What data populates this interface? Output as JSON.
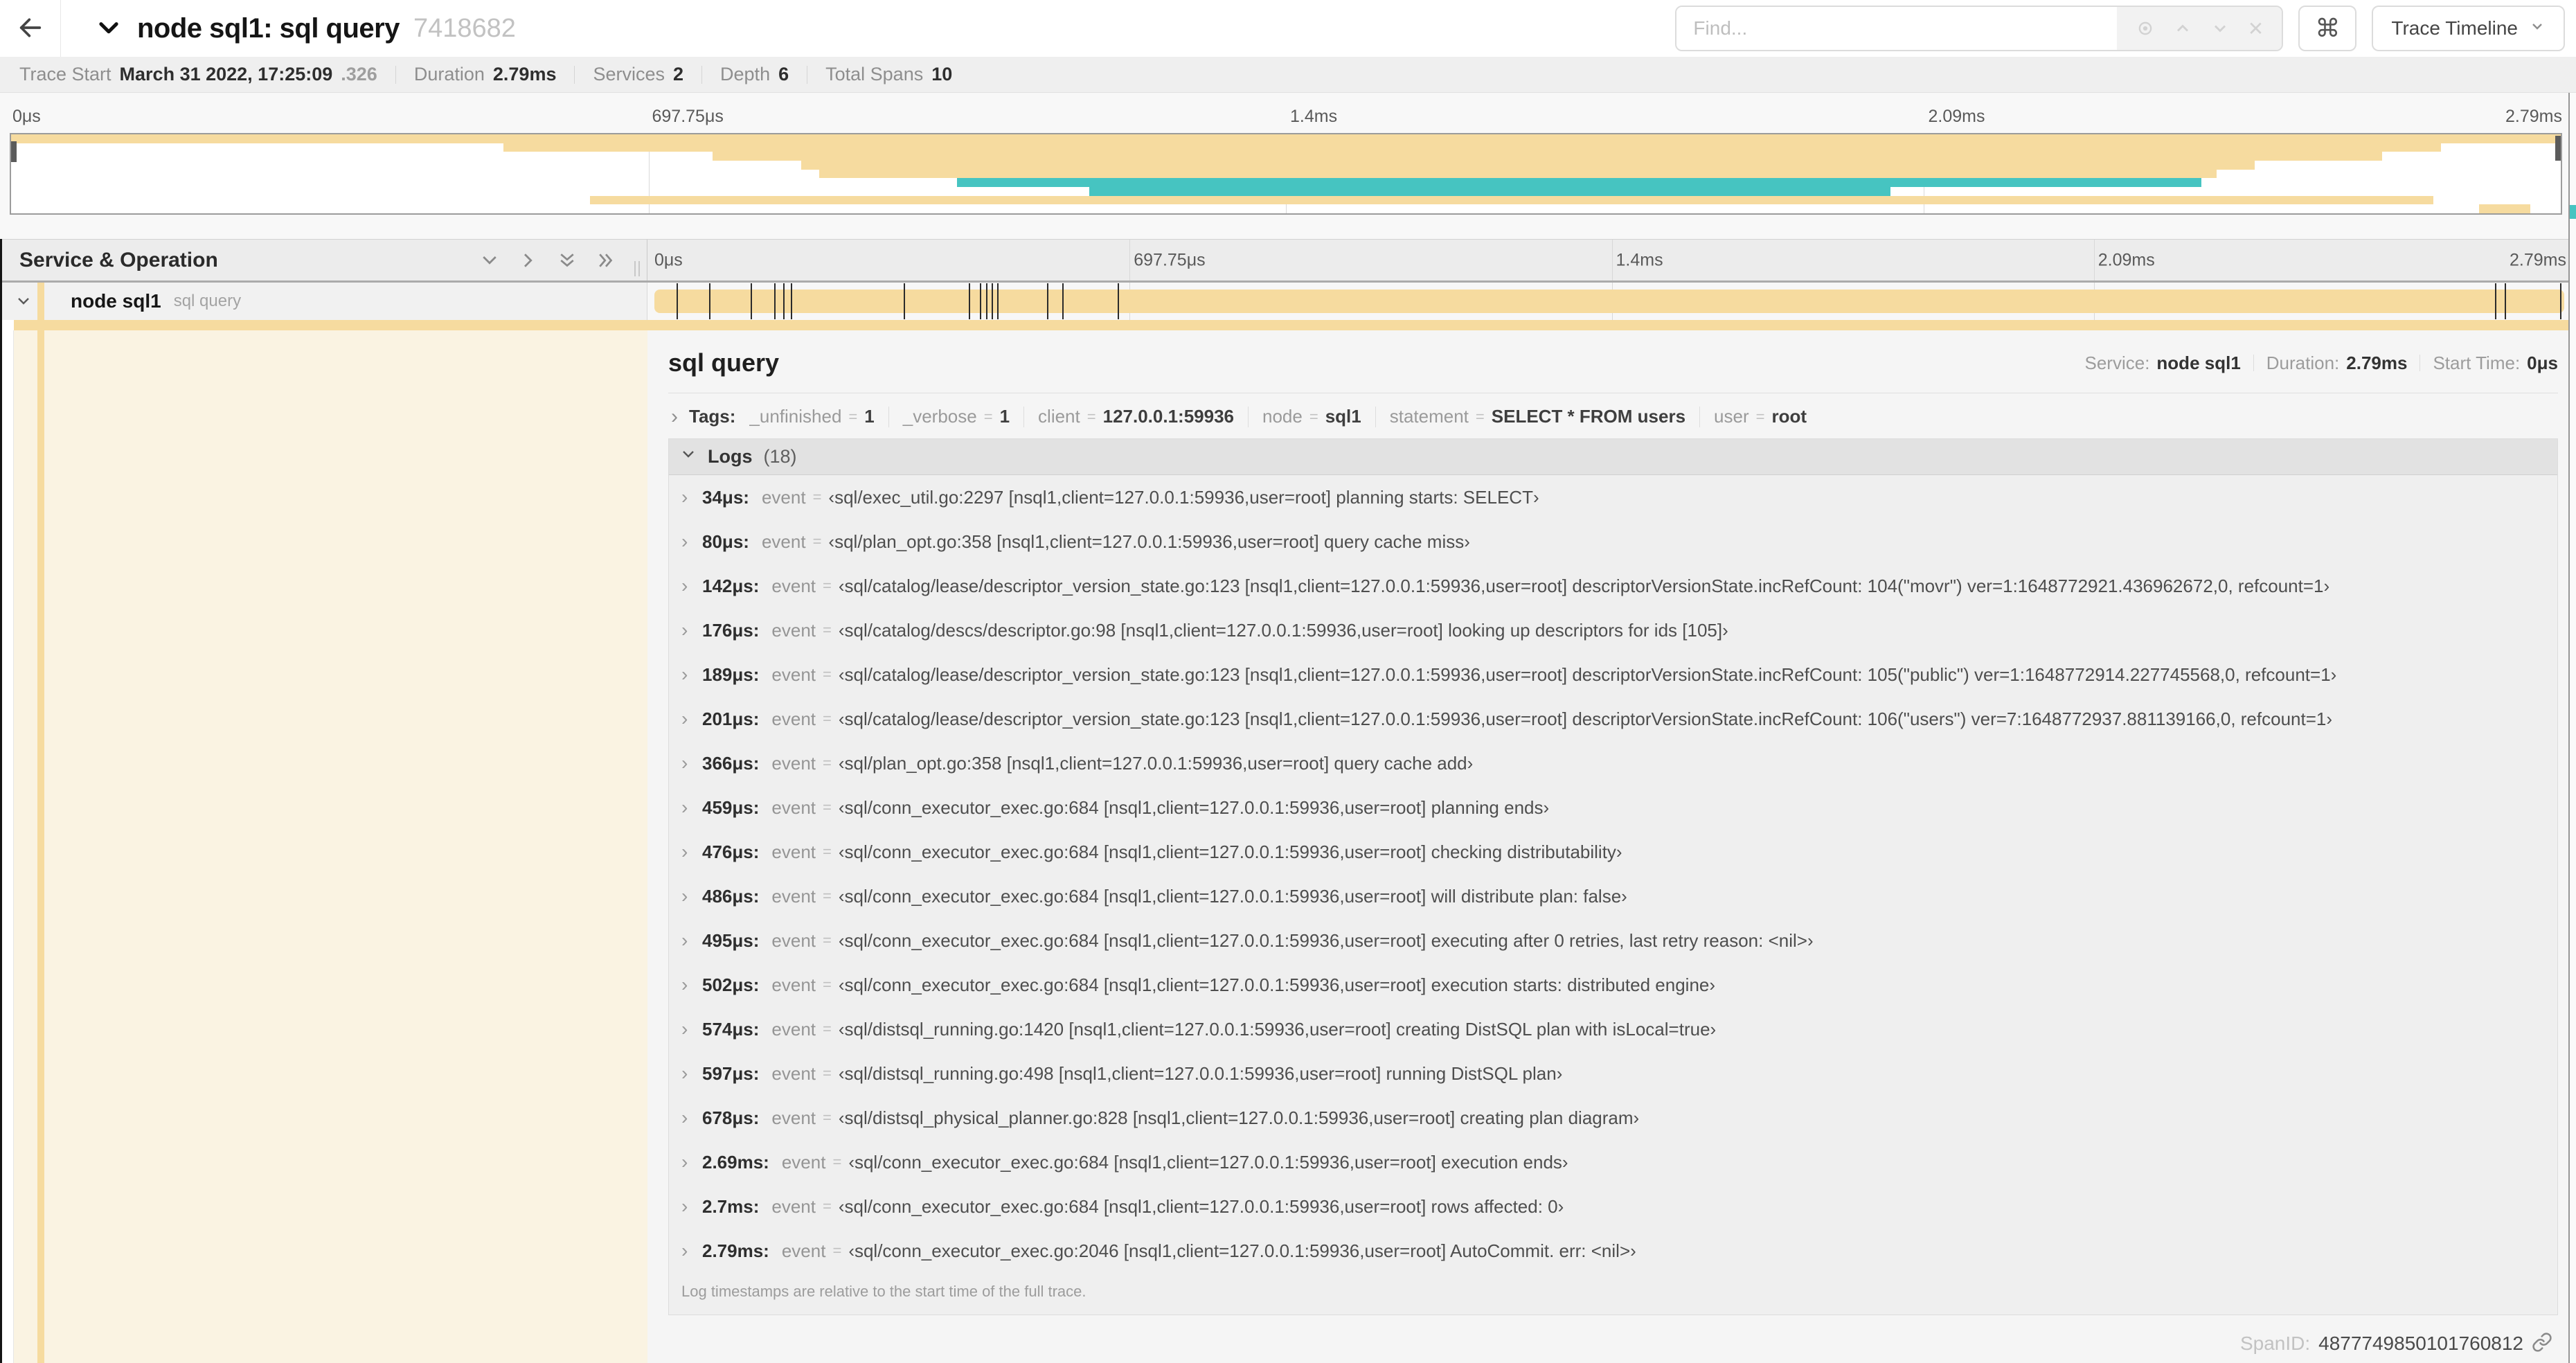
{
  "colors": {
    "span_bar": "#F6DB9F",
    "span_detail_bg": "#FAF3E2",
    "teal": "#46C4C1"
  },
  "header": {
    "back_icon": "arrow-left",
    "title": "node sql1: sql query",
    "trace_id": "7418682",
    "find_placeholder": "Find...",
    "cmd_icon": "⌘",
    "close_icon": "✕",
    "view_selector_label": "Trace Timeline"
  },
  "trace_meta": {
    "items": [
      {
        "label": "Trace Start",
        "value": "March 31 2022, 17:25:09",
        "suffix": ".326"
      },
      {
        "label": "Duration",
        "value": "2.79ms"
      },
      {
        "label": "Services",
        "value": "2"
      },
      {
        "label": "Depth",
        "value": "6"
      },
      {
        "label": "Total Spans",
        "value": "10"
      }
    ]
  },
  "minimap": {
    "ticks": [
      "0μs",
      "697.75μs",
      "1.4ms",
      "2.09ms",
      "2.79ms"
    ],
    "rows": [
      {
        "start": 0,
        "end": 100,
        "color": "#F6DB9F"
      },
      {
        "start": 19.3,
        "end": 95.3,
        "color": "#F6DB9F"
      },
      {
        "start": 27.5,
        "end": 93,
        "color": "#F6DB9F"
      },
      {
        "start": 31,
        "end": 88,
        "color": "#F6DB9F"
      },
      {
        "start": 31.7,
        "end": 86.5,
        "color": "#F6DB9F"
      },
      {
        "start": 37.1,
        "end": 85.9,
        "color": "#46C4C1"
      },
      {
        "start": 42.3,
        "end": 73.7,
        "color": "#46C4C1"
      },
      {
        "start": 22.7,
        "end": 95,
        "color": "#F6DB9F"
      },
      {
        "start": 96.8,
        "end": 98.8,
        "color": "#F6DB9F"
      }
    ]
  },
  "grid": {
    "left_title": "Service & Operation",
    "ticks": [
      "0μs",
      "697.75μs",
      "1.4ms",
      "2.09ms",
      "2.79ms"
    ]
  },
  "span_row": {
    "service": "node sql1",
    "operation": "sql query",
    "log_marker_pcts": [
      1.2,
      2.9,
      5.1,
      6.3,
      6.8,
      7.2,
      13.1,
      16.5,
      17.1,
      17.4,
      17.7,
      18.0,
      20.6,
      21.4,
      24.3,
      96.4,
      96.9,
      99.8
    ]
  },
  "detail": {
    "title": "sql query",
    "meta": [
      {
        "label": "Service:",
        "value": "node sql1"
      },
      {
        "label": "Duration:",
        "value": "2.79ms"
      },
      {
        "label": "Start Time:",
        "value": "0μs"
      }
    ],
    "tags": {
      "label": "Tags:",
      "items": [
        {
          "key": "_unfinished",
          "value": "1"
        },
        {
          "key": "_verbose",
          "value": "1"
        },
        {
          "key": "client",
          "value": "127.0.0.1:59936"
        },
        {
          "key": "node",
          "value": "sql1"
        },
        {
          "key": "statement",
          "value": "SELECT * FROM users"
        },
        {
          "key": "user",
          "value": "root"
        }
      ]
    },
    "logs": {
      "label": "Logs",
      "count": "(18)",
      "field_key": "event",
      "entries": [
        {
          "time": "34μs:",
          "value": "‹sql/exec_util.go:2297 [nsql1,client=127.0.0.1:59936,user=root] planning starts: SELECT›"
        },
        {
          "time": "80μs:",
          "value": "‹sql/plan_opt.go:358 [nsql1,client=127.0.0.1:59936,user=root] query cache miss›"
        },
        {
          "time": "142μs:",
          "value": "‹sql/catalog/lease/descriptor_version_state.go:123 [nsql1,client=127.0.0.1:59936,user=root] descriptorVersionState.incRefCount: 104(\"movr\") ver=1:1648772921.436962672,0, refcount=1›"
        },
        {
          "time": "176μs:",
          "value": "‹sql/catalog/descs/descriptor.go:98 [nsql1,client=127.0.0.1:59936,user=root] looking up descriptors for ids [105]›"
        },
        {
          "time": "189μs:",
          "value": "‹sql/catalog/lease/descriptor_version_state.go:123 [nsql1,client=127.0.0.1:59936,user=root] descriptorVersionState.incRefCount: 105(\"public\") ver=1:1648772914.227745568,0, refcount=1›"
        },
        {
          "time": "201μs:",
          "value": "‹sql/catalog/lease/descriptor_version_state.go:123 [nsql1,client=127.0.0.1:59936,user=root] descriptorVersionState.incRefCount: 106(\"users\") ver=7:1648772937.881139166,0, refcount=1›"
        },
        {
          "time": "366μs:",
          "value": "‹sql/plan_opt.go:358 [nsql1,client=127.0.0.1:59936,user=root] query cache add›"
        },
        {
          "time": "459μs:",
          "value": "‹sql/conn_executor_exec.go:684 [nsql1,client=127.0.0.1:59936,user=root] planning ends›"
        },
        {
          "time": "476μs:",
          "value": "‹sql/conn_executor_exec.go:684 [nsql1,client=127.0.0.1:59936,user=root] checking distributability›"
        },
        {
          "time": "486μs:",
          "value": "‹sql/conn_executor_exec.go:684 [nsql1,client=127.0.0.1:59936,user=root] will distribute plan: false›"
        },
        {
          "time": "495μs:",
          "value": "‹sql/conn_executor_exec.go:684 [nsql1,client=127.0.0.1:59936,user=root] executing after 0 retries, last retry reason: <nil>›"
        },
        {
          "time": "502μs:",
          "value": "‹sql/conn_executor_exec.go:684 [nsql1,client=127.0.0.1:59936,user=root] execution starts: distributed engine›"
        },
        {
          "time": "574μs:",
          "value": "‹sql/distsql_running.go:1420 [nsql1,client=127.0.0.1:59936,user=root] creating DistSQL plan with isLocal=true›"
        },
        {
          "time": "597μs:",
          "value": "‹sql/distsql_running.go:498 [nsql1,client=127.0.0.1:59936,user=root] running DistSQL plan›"
        },
        {
          "time": "678μs:",
          "value": "‹sql/distsql_physical_planner.go:828 [nsql1,client=127.0.0.1:59936,user=root] creating plan diagram›"
        },
        {
          "time": "2.69ms:",
          "value": "‹sql/conn_executor_exec.go:684 [nsql1,client=127.0.0.1:59936,user=root] execution ends›"
        },
        {
          "time": "2.7ms:",
          "value": "‹sql/conn_executor_exec.go:684 [nsql1,client=127.0.0.1:59936,user=root] rows affected: 0›"
        },
        {
          "time": "2.79ms:",
          "value": "‹sql/conn_executor_exec.go:2046 [nsql1,client=127.0.0.1:59936,user=root] AutoCommit. err: <nil>›"
        }
      ],
      "footer": "Log timestamps are relative to the start time of the full trace."
    },
    "span_id_label": "SpanID:",
    "span_id": "4877749850101760812"
  },
  "icons": {
    "chevron_right": "›",
    "tags_chevron": "›"
  }
}
